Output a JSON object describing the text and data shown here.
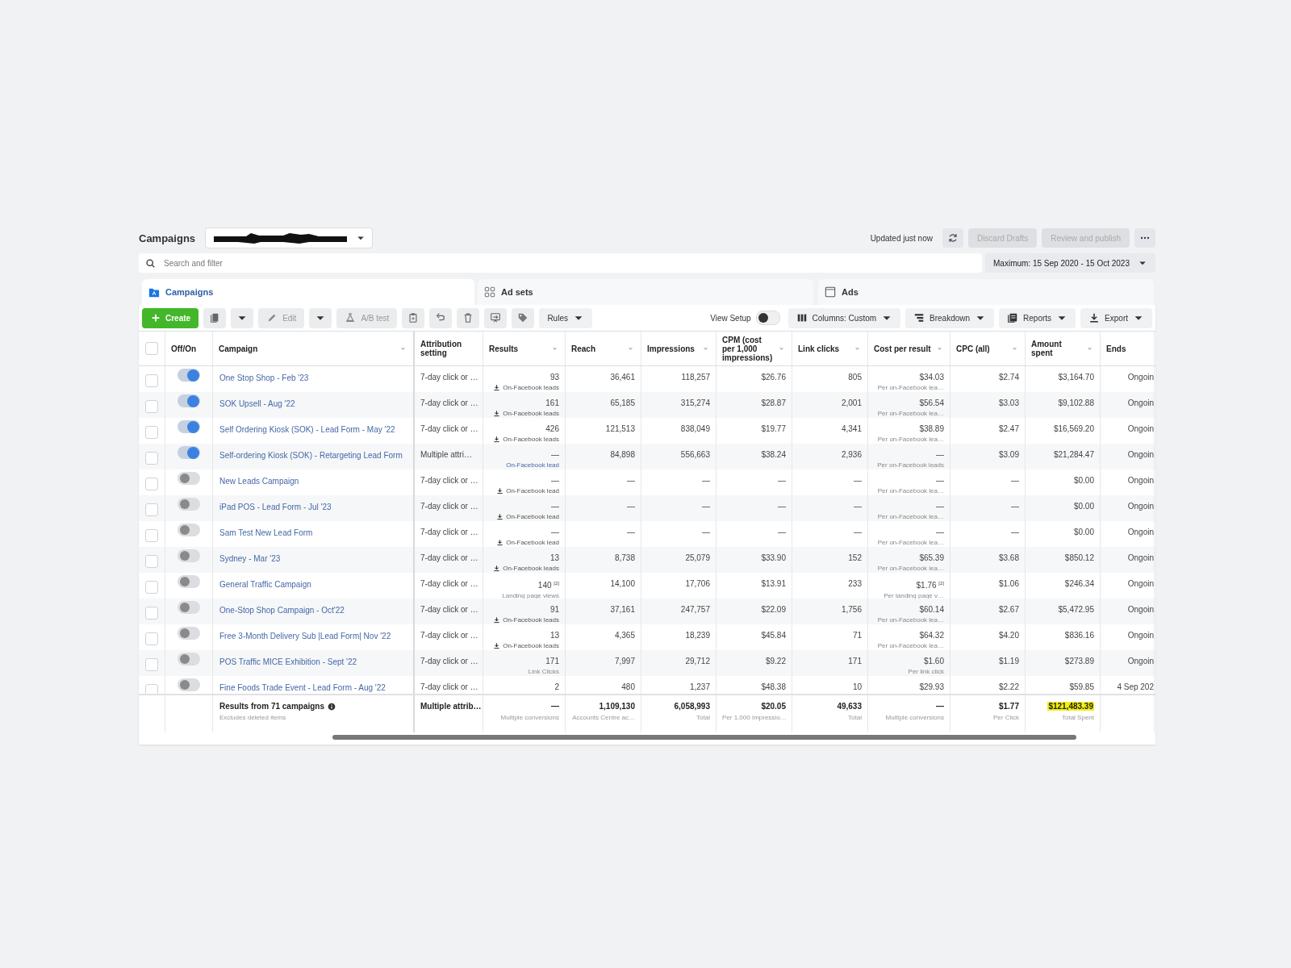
{
  "header": {
    "title": "Campaigns",
    "updated": "Updated just now",
    "actions": [
      {
        "label": "Discard Drafts",
        "disabled": true
      },
      {
        "label": "Review and publish",
        "disabled": true
      }
    ]
  },
  "search": {
    "placeholder": "Search and filter"
  },
  "date_range": "Maximum: 15 Sep 2020 - 15 Oct 2023",
  "tabs": [
    {
      "label": "Campaigns",
      "selected": true
    },
    {
      "label": "Ad sets",
      "selected": false
    },
    {
      "label": "Ads",
      "selected": false
    }
  ],
  "toolbar": {
    "left": [
      {
        "kind": "primary",
        "label": "Create"
      },
      {
        "kind": "icon"
      },
      {
        "kind": "caret"
      },
      {
        "kind": "text",
        "label": "Edit",
        "disabled": true
      },
      {
        "kind": "caret"
      },
      {
        "kind": "text",
        "label": "A/B test",
        "disabled": true
      },
      {
        "kind": "icon"
      },
      {
        "kind": "icon"
      },
      {
        "kind": "icon"
      },
      {
        "kind": "icon"
      },
      {
        "kind": "icon"
      },
      {
        "kind": "menu",
        "label": "Rules"
      }
    ],
    "view_setup": {
      "label": "View Setup",
      "on": false
    },
    "right": [
      {
        "label": "Columns: Custom"
      },
      {
        "label": "Breakdown"
      },
      {
        "label": "Reports"
      },
      {
        "label": "Export"
      }
    ]
  },
  "table": {
    "select_all": {
      "checked": false
    },
    "columns": [
      {
        "label": "Off/On",
        "sort_menu": false
      },
      {
        "label": "Campaign",
        "sort_menu": true
      },
      {
        "label": "Attribution setting",
        "sort_menu": false
      },
      {
        "label": "Results",
        "sort_menu": true
      },
      {
        "label": "Reach",
        "sort_menu": true
      },
      {
        "label": "Impressions",
        "sort_menu": true
      },
      {
        "label": "CPM (cost per 1,000 impressions)",
        "sort_menu": true
      },
      {
        "label": "Link clicks",
        "sort_menu": true
      },
      {
        "label": "Cost per result",
        "sort_menu": true
      },
      {
        "label": "CPC (all)",
        "sort_menu": true
      },
      {
        "label": "Amount spent",
        "sort_menu": true
      },
      {
        "label": "Ends",
        "sort_menu": false
      }
    ],
    "rows": [
      {
        "selected": false,
        "on": true,
        "campaign": "One Stop Shop - Feb '23",
        "attribution": "7-day click or …",
        "results": {
          "value": "93",
          "note": "On-Facebook leads",
          "kind": "download"
        },
        "reach": "36,461",
        "impressions": "118,257",
        "cpm": "$26.76",
        "link_clicks": "805",
        "cost_per_result": {
          "value": "$34.03",
          "note": "Per on-Facebook lea…"
        },
        "cpc": "$2.74",
        "amount_spent": "$3,164.70",
        "ends": "Ongoin"
      },
      {
        "selected": false,
        "on": true,
        "campaign": "SOK Upsell - Aug '22",
        "attribution": "7-day click or …",
        "results": {
          "value": "161",
          "note": "On-Facebook leads",
          "kind": "download"
        },
        "reach": "65,185",
        "impressions": "315,274",
        "cpm": "$28.87",
        "link_clicks": "2,001",
        "cost_per_result": {
          "value": "$56.54",
          "note": "Per on-Facebook lea…"
        },
        "cpc": "$3.03",
        "amount_spent": "$9,102.88",
        "ends": "Ongoin"
      },
      {
        "selected": false,
        "on": true,
        "campaign": "Self Ordering Kiosk (SOK) - Lead Form - May '22",
        "attribution": "7-day click or …",
        "results": {
          "value": "426",
          "note": "On-Facebook leads",
          "kind": "download"
        },
        "reach": "121,513",
        "impressions": "838,049",
        "cpm": "$19.77",
        "link_clicks": "4,341",
        "cost_per_result": {
          "value": "$38.89",
          "note": "Per on-Facebook lea…"
        },
        "cpc": "$2.47",
        "amount_spent": "$16,569.20",
        "ends": "Ongoin"
      },
      {
        "selected": false,
        "on": true,
        "campaign": "Self-ordering Kiosk (SOK) - Retargeting Lead Form",
        "attribution": "Multiple attri…",
        "results": {
          "value": "—",
          "note": "On-Facebook lead",
          "kind": "link"
        },
        "reach": "84,898",
        "impressions": "556,663",
        "cpm": "$38.24",
        "link_clicks": "2,936",
        "cost_per_result": {
          "value": "—",
          "note": "Per on-Facebook leads"
        },
        "cpc": "$3.09",
        "amount_spent": "$21,284.47",
        "ends": "Ongoin"
      },
      {
        "selected": false,
        "on": false,
        "campaign": "New Leads Campaign",
        "attribution": "7-day click or …",
        "results": {
          "value": "—",
          "note": "On-Facebook lead",
          "kind": "download"
        },
        "reach": "—",
        "impressions": "—",
        "cpm": "—",
        "link_clicks": "—",
        "cost_per_result": {
          "value": "—",
          "note": "Per on-Facebook lea…"
        },
        "cpc": "—",
        "amount_spent": "$0.00",
        "ends": "Ongoin"
      },
      {
        "selected": false,
        "on": false,
        "campaign": "iPad POS - Lead Form - Jul '23",
        "attribution": "7-day click or …",
        "results": {
          "value": "—",
          "note": "On-Facebook lead",
          "kind": "download"
        },
        "reach": "—",
        "impressions": "—",
        "cpm": "—",
        "link_clicks": "—",
        "cost_per_result": {
          "value": "—",
          "note": "Per on-Facebook lea…"
        },
        "cpc": "—",
        "amount_spent": "$0.00",
        "ends": "Ongoin"
      },
      {
        "selected": false,
        "on": false,
        "campaign": "Sam Test New Lead Form",
        "attribution": "7-day click or …",
        "results": {
          "value": "—",
          "note": "On-Facebook lead",
          "kind": "download"
        },
        "reach": "—",
        "impressions": "—",
        "cpm": "—",
        "link_clicks": "—",
        "cost_per_result": {
          "value": "—",
          "note": "Per on-Facebook lea…"
        },
        "cpc": "—",
        "amount_spent": "$0.00",
        "ends": "Ongoin"
      },
      {
        "selected": false,
        "on": false,
        "campaign": "Sydney - Mar '23",
        "attribution": "7-day click or …",
        "results": {
          "value": "13",
          "note": "On-Facebook leads",
          "kind": "download"
        },
        "reach": "8,738",
        "impressions": "25,079",
        "cpm": "$33.90",
        "link_clicks": "152",
        "cost_per_result": {
          "value": "$65.39",
          "note": "Per on-Facebook lea…"
        },
        "cpc": "$3.68",
        "amount_spent": "$850.12",
        "ends": "Ongoin"
      },
      {
        "selected": false,
        "on": false,
        "campaign": "General Traffic Campaign",
        "attribution": "7-day click or …",
        "results": {
          "value": "140 $^{[2]}$",
          "note": "Landing page views",
          "kind": "plain"
        },
        "reach": "14,100",
        "impressions": "17,706",
        "cpm": "$13.91",
        "link_clicks": "233",
        "cost_per_result": {
          "value": "$1.76 $^{[2]}$",
          "note": "Per landing page v…"
        },
        "cpc": "$1.06",
        "amount_spent": "$246.34",
        "ends": "Ongoin"
      },
      {
        "selected": false,
        "on": false,
        "campaign": "One-Stop Shop Campaign - Oct'22",
        "attribution": "7-day click or …",
        "results": {
          "value": "91",
          "note": "On-Facebook leads",
          "kind": "download"
        },
        "reach": "37,161",
        "impressions": "247,757",
        "cpm": "$22.09",
        "link_clicks": "1,756",
        "cost_per_result": {
          "value": "$60.14",
          "note": "Per on-Facebook lea…"
        },
        "cpc": "$2.67",
        "amount_spent": "$5,472.95",
        "ends": "Ongoin"
      },
      {
        "selected": false,
        "on": false,
        "campaign": "Free 3-Month Delivery Sub |Lead Form| Nov '22",
        "attribution": "7-day click or …",
        "results": {
          "value": "13",
          "note": "On-Facebook leads",
          "kind": "download"
        },
        "reach": "4,365",
        "impressions": "18,239",
        "cpm": "$45.84",
        "link_clicks": "71",
        "cost_per_result": {
          "value": "$64.32",
          "note": "Per on-Facebook lea…"
        },
        "cpc": "$4.20",
        "amount_spent": "$836.16",
        "ends": "Ongoin"
      },
      {
        "selected": false,
        "on": false,
        "campaign": "POS Traffic MICE Exhibition - Sept '22",
        "attribution": "7-day click or …",
        "results": {
          "value": "171",
          "note": "Link Clicks",
          "kind": "plain"
        },
        "reach": "7,997",
        "impressions": "29,712",
        "cpm": "$9.22",
        "link_clicks": "171",
        "cost_per_result": {
          "value": "$1.60",
          "note": "Per link click"
        },
        "cpc": "$1.19",
        "amount_spent": "$273.89",
        "ends": "Ongoin"
      },
      {
        "selected": false,
        "on": false,
        "campaign": "Fine Foods Trade Event - Lead Form - Aug '22",
        "attribution": "7-day click or …",
        "results": {
          "value": "2"
        },
        "reach": "480",
        "impressions": "1,237",
        "cpm": "$48.38",
        "link_clicks": "10",
        "cost_per_result": {
          "value": "$29.93"
        },
        "cpc": "$2.22",
        "amount_spent": "$59.85",
        "ends": "4 Sep 202"
      }
    ],
    "footer": {
      "label": "Results from 71 campaigns",
      "note": "Excludes deleted items",
      "attribution": "Multiple attrib…",
      "cells": [
        {
          "value": "—",
          "note": "Multiple conversions",
          "highlighted": false
        },
        {
          "value": "1,109,130",
          "note": "Accounts Centre ac…",
          "highlighted": false
        },
        {
          "value": "6,058,993",
          "note": "Total",
          "highlighted": false
        },
        {
          "value": "$20.05",
          "note": "Per 1,000 Impressio…",
          "highlighted": false
        },
        {
          "value": "49,633",
          "note": "Total",
          "highlighted": false
        },
        {
          "value": "—",
          "note": "Multiple conversions",
          "highlighted": false
        },
        {
          "value": "$1.77",
          "note": "Per Click",
          "highlighted": false
        },
        {
          "value": "$121,483.39",
          "note": "Total Spent",
          "highlighted": true
        }
      ]
    }
  }
}
